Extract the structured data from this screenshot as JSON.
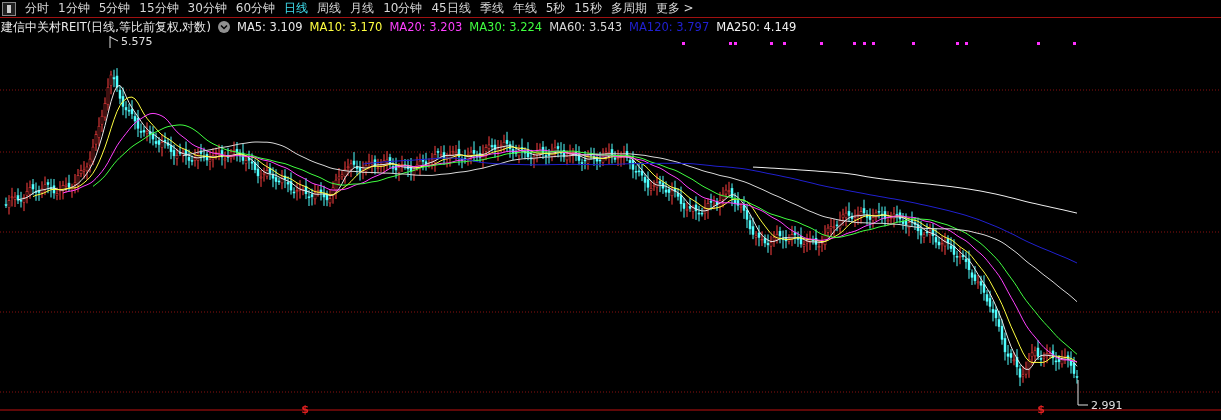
{
  "toolbar": {
    "tabs": [
      {
        "label": "分时",
        "selected": false
      },
      {
        "label": "1分钟",
        "selected": false
      },
      {
        "label": "5分钟",
        "selected": false
      },
      {
        "label": "15分钟",
        "selected": false
      },
      {
        "label": "30分钟",
        "selected": false
      },
      {
        "label": "60分钟",
        "selected": false
      },
      {
        "label": "日线",
        "selected": true
      },
      {
        "label": "周线",
        "selected": false
      },
      {
        "label": "月线",
        "selected": false
      },
      {
        "label": "10分钟",
        "selected": false
      },
      {
        "label": "45日线",
        "selected": false
      },
      {
        "label": "季线",
        "selected": false
      },
      {
        "label": "年线",
        "selected": false
      },
      {
        "label": "5秒",
        "selected": false
      },
      {
        "label": "15秒",
        "selected": false
      },
      {
        "label": "多周期",
        "selected": false
      },
      {
        "label": "更多 >",
        "selected": false
      }
    ]
  },
  "legend": {
    "title": "建信中关村REIT(日线,等比前复权,对数)",
    "indicators": [
      {
        "label": "MA5: 3.109",
        "color": "#e8e8e8"
      },
      {
        "label": "MA10: 3.170",
        "color": "#ffff40"
      },
      {
        "label": "MA20: 3.203",
        "color": "#ff40ff"
      },
      {
        "label": "MA30: 3.224",
        "color": "#40ff40"
      },
      {
        "label": "MA60: 3.543",
        "color": "#d8d8d8"
      },
      {
        "label": "MA120: 3.797",
        "color": "#2020d0"
      },
      {
        "label": "MA250: 4.149",
        "color": "#f0f0f0"
      }
    ]
  },
  "chart": {
    "high_label": "5.575",
    "low_label": "2.991",
    "signal_markers": [
      "$",
      "$"
    ]
  }
}
